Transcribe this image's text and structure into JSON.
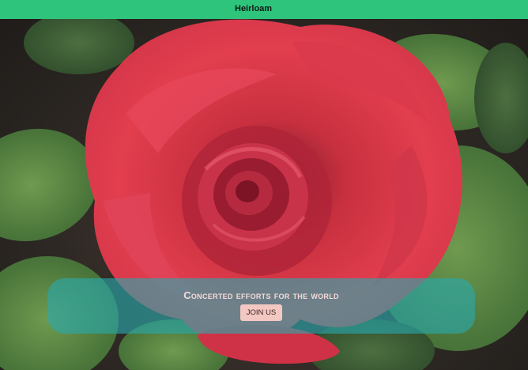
{
  "header": {
    "brand": "Heirloam",
    "background_color": "#2fc47c"
  },
  "hero": {
    "image_subject": "red-rose",
    "headline": "Concerted efforts for the world",
    "cta_label": "JOIN US",
    "overlay_color": "#28aaaf",
    "cta_color": "#f3c8c3"
  }
}
